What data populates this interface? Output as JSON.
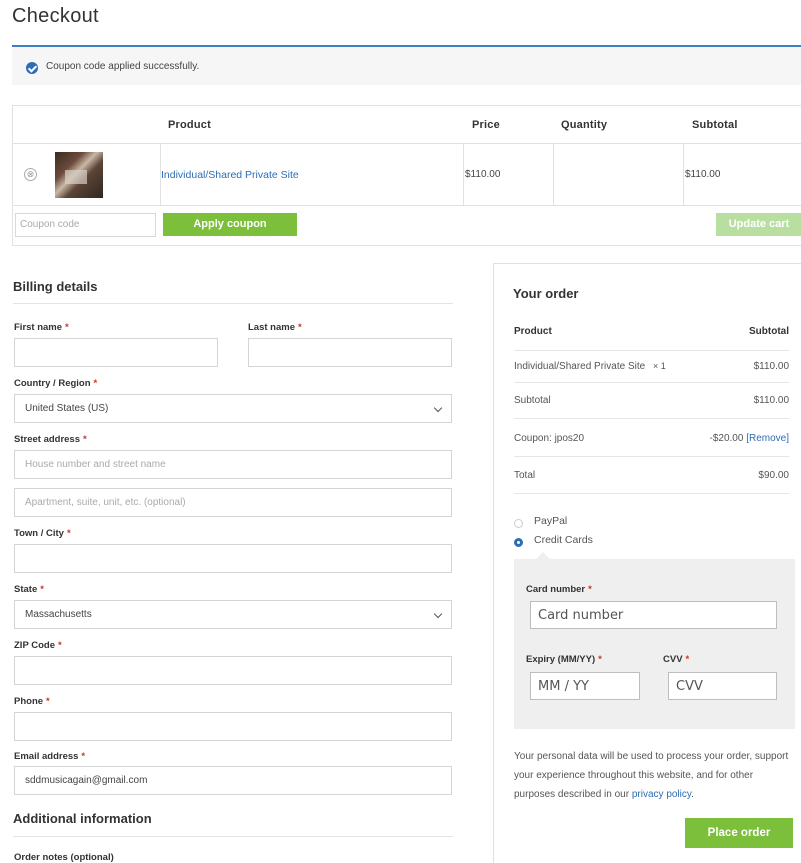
{
  "page": {
    "title": "Checkout"
  },
  "notice": {
    "message": "Coupon code applied successfully."
  },
  "cart": {
    "headers": {
      "product": "Product",
      "price": "Price",
      "quantity": "Quantity",
      "subtotal": "Subtotal"
    },
    "item": {
      "remove": "⊗",
      "name": "Individual/Shared Private Site",
      "price": "$110.00",
      "quantity": "",
      "subtotal": "$110.00"
    },
    "coupon_placeholder": "Coupon code",
    "apply_label": "Apply coupon",
    "update_label": "Update cart"
  },
  "billing": {
    "title": "Billing details",
    "first_name_label": "First name",
    "last_name_label": "Last name",
    "country_label": "Country / Region",
    "country_value": "United States (US)",
    "street_label": "Street address",
    "street_placeholder": "House number and street name",
    "street2_placeholder": "Apartment, suite, unit, etc. (optional)",
    "city_label": "Town / City",
    "state_label": "State",
    "state_value": "Massachusetts",
    "zip_label": "ZIP Code",
    "phone_label": "Phone",
    "email_label": "Email address",
    "email_value": "sddmusicagain@gmail.com",
    "required_mark": "*"
  },
  "additional": {
    "title": "Additional information",
    "notes_label": "Order notes (optional)"
  },
  "order": {
    "title": "Your order",
    "head_product": "Product",
    "head_subtotal": "Subtotal",
    "line_item": "Individual/Shared Private Site",
    "line_qty": "× 1",
    "line_amount": "$110.00",
    "subtotal_label": "Subtotal",
    "subtotal_value": "$110.00",
    "coupon_label": "Coupon: jpos20",
    "coupon_value": "-$20.00",
    "coupon_remove": "[Remove]",
    "total_label": "Total",
    "total_value": "$90.00"
  },
  "payment": {
    "options": [
      "PayPal",
      "Credit Cards"
    ],
    "selected": "Credit Cards",
    "card_number_label": "Card number",
    "card_number_placeholder": "Card number",
    "expiry_label": "Expiry (MM/YY)",
    "expiry_placeholder": "MM / YY",
    "cvv_label": "CVV",
    "cvv_placeholder": "CVV",
    "privacy_text": "Your personal data will be used to process your order, support your experience throughout this website, and for other purposes described in our",
    "privacy_link": "privacy policy",
    "privacy_end": ".",
    "place_order_label": "Place order"
  },
  "colors": {
    "accent": "#2d6db5",
    "button": "#7cbf3a",
    "notice_border": "#3d7dc8",
    "required": "#c0392b"
  }
}
